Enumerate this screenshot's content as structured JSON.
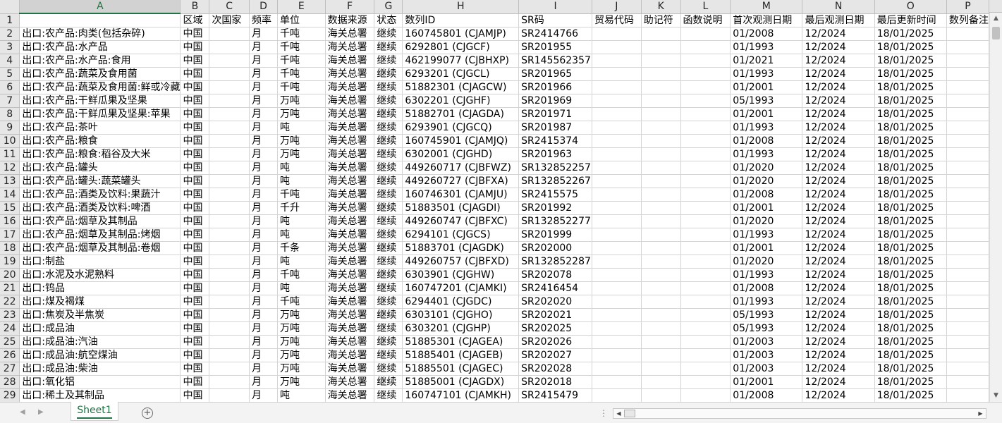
{
  "columns": [
    "A",
    "B",
    "C",
    "D",
    "E",
    "F",
    "G",
    "H",
    "I",
    "J",
    "K",
    "L",
    "M",
    "N",
    "O",
    "P"
  ],
  "selected_column": "A",
  "header_row": {
    "row_num": "1",
    "cells": [
      "",
      "区域",
      "次国家",
      "频率",
      "单位",
      "数据来源",
      "状态",
      "数列ID",
      "SR码",
      "贸易代码",
      "助记符",
      "函数说明",
      "首次观测日期",
      "最后观测日期",
      "最后更新时间",
      "数列备注"
    ]
  },
  "rows": [
    {
      "n": "2",
      "cells": [
        "出口:农产品:肉类(包括杂碎)",
        "中国",
        "",
        "月",
        "千吨",
        "海关总署",
        "继续",
        "160745801 (CJAMJP)",
        "SR2414766",
        "",
        "",
        "",
        "01/2008",
        "12/2024",
        "18/01/2025",
        ""
      ]
    },
    {
      "n": "3",
      "cells": [
        "出口:农产品:水产品",
        "中国",
        "",
        "月",
        "千吨",
        "海关总署",
        "继续",
        "6292801 (CJGCF)",
        "SR201955",
        "",
        "",
        "",
        "01/1993",
        "12/2024",
        "18/01/2025",
        ""
      ]
    },
    {
      "n": "4",
      "cells": [
        "出口:农产品:水产品:食用",
        "中国",
        "",
        "月",
        "千吨",
        "海关总署",
        "继续",
        "462199077 (CJBHXP)",
        "SR145562357",
        "",
        "",
        "",
        "01/2021",
        "12/2024",
        "18/01/2025",
        ""
      ]
    },
    {
      "n": "5",
      "cells": [
        "出口:农产品:蔬菜及食用菌",
        "中国",
        "",
        "月",
        "千吨",
        "海关总署",
        "继续",
        "6293201 (CJGCL)",
        "SR201965",
        "",
        "",
        "",
        "01/1993",
        "12/2024",
        "18/01/2025",
        ""
      ]
    },
    {
      "n": "6",
      "cells": [
        "出口:农产品:蔬菜及食用菌:鲜或冷藏",
        "中国",
        "",
        "月",
        "千吨",
        "海关总署",
        "继续",
        "51882301 (CJAGCW)",
        "SR201966",
        "",
        "",
        "",
        "01/2001",
        "12/2024",
        "18/01/2025",
        ""
      ]
    },
    {
      "n": "7",
      "cells": [
        "出口:农产品:干鲜瓜果及坚果",
        "中国",
        "",
        "月",
        "万吨",
        "海关总署",
        "继续",
        "6302201 (CJGHF)",
        "SR201969",
        "",
        "",
        "",
        "05/1993",
        "12/2024",
        "18/01/2025",
        ""
      ]
    },
    {
      "n": "8",
      "cells": [
        "出口:农产品:干鲜瓜果及坚果:苹果",
        "中国",
        "",
        "月",
        "万吨",
        "海关总署",
        "继续",
        "51882701 (CJAGDA)",
        "SR201971",
        "",
        "",
        "",
        "01/2001",
        "12/2024",
        "18/01/2025",
        ""
      ]
    },
    {
      "n": "9",
      "cells": [
        "出口:农产品:茶叶",
        "中国",
        "",
        "月",
        "吨",
        "海关总署",
        "继续",
        "6293901 (CJGCQ)",
        "SR201987",
        "",
        "",
        "",
        "01/1993",
        "12/2024",
        "18/01/2025",
        ""
      ]
    },
    {
      "n": "10",
      "cells": [
        "出口:农产品:粮食",
        "中国",
        "",
        "月",
        "万吨",
        "海关总署",
        "继续",
        "160745901 (CJAMJQ)",
        "SR2415374",
        "",
        "",
        "",
        "01/2008",
        "12/2024",
        "18/01/2025",
        ""
      ]
    },
    {
      "n": "11",
      "cells": [
        "出口:农产品:粮食:稻谷及大米",
        "中国",
        "",
        "月",
        "万吨",
        "海关总署",
        "继续",
        "6302001 (CJGHD)",
        "SR201963",
        "",
        "",
        "",
        "01/1993",
        "12/2024",
        "18/01/2025",
        ""
      ]
    },
    {
      "n": "12",
      "cells": [
        "出口:农产品:罐头",
        "中国",
        "",
        "月",
        "吨",
        "海关总署",
        "继续",
        "449260717 (CJBFWZ)",
        "SR132852257",
        "",
        "",
        "",
        "01/2020",
        "12/2024",
        "18/01/2025",
        ""
      ]
    },
    {
      "n": "13",
      "cells": [
        "出口:农产品:罐头:蔬菜罐头",
        "中国",
        "",
        "月",
        "吨",
        "海关总署",
        "继续",
        "449260727 (CJBFXA)",
        "SR132852267",
        "",
        "",
        "",
        "01/2020",
        "12/2024",
        "18/01/2025",
        ""
      ]
    },
    {
      "n": "14",
      "cells": [
        "出口:农产品:酒类及饮料:果蔬汁",
        "中国",
        "",
        "月",
        "千吨",
        "海关总署",
        "继续",
        "160746301 (CJAMJU)",
        "SR2415575",
        "",
        "",
        "",
        "01/2008",
        "12/2024",
        "18/01/2025",
        ""
      ]
    },
    {
      "n": "15",
      "cells": [
        "出口:农产品:酒类及饮料:啤酒",
        "中国",
        "",
        "月",
        "千升",
        "海关总署",
        "继续",
        "51883501 (CJAGDI)",
        "SR201992",
        "",
        "",
        "",
        "01/2001",
        "12/2024",
        "18/01/2025",
        ""
      ]
    },
    {
      "n": "16",
      "cells": [
        "出口:农产品:烟草及其制品",
        "中国",
        "",
        "月",
        "吨",
        "海关总署",
        "继续",
        "449260747 (CJBFXC)",
        "SR132852277",
        "",
        "",
        "",
        "01/2020",
        "12/2024",
        "18/01/2025",
        ""
      ]
    },
    {
      "n": "17",
      "cells": [
        "出口:农产品:烟草及其制品:烤烟",
        "中国",
        "",
        "月",
        "吨",
        "海关总署",
        "继续",
        "6294101 (CJGCS)",
        "SR201999",
        "",
        "",
        "",
        "01/1993",
        "12/2024",
        "18/01/2025",
        ""
      ]
    },
    {
      "n": "18",
      "cells": [
        "出口:农产品:烟草及其制品:卷烟",
        "中国",
        "",
        "月",
        "千条",
        "海关总署",
        "继续",
        "51883701 (CJAGDK)",
        "SR202000",
        "",
        "",
        "",
        "01/2001",
        "12/2024",
        "18/01/2025",
        ""
      ]
    },
    {
      "n": "19",
      "cells": [
        "出口:制盐",
        "中国",
        "",
        "月",
        "吨",
        "海关总署",
        "继续",
        "449260757 (CJBFXD)",
        "SR132852287",
        "",
        "",
        "",
        "01/2020",
        "12/2024",
        "18/01/2025",
        ""
      ]
    },
    {
      "n": "20",
      "cells": [
        "出口:水泥及水泥熟料",
        "中国",
        "",
        "月",
        "千吨",
        "海关总署",
        "继续",
        "6303901 (CJGHW)",
        "SR202078",
        "",
        "",
        "",
        "01/1993",
        "12/2024",
        "18/01/2025",
        ""
      ]
    },
    {
      "n": "21",
      "cells": [
        "出口:钨品",
        "中国",
        "",
        "月",
        "吨",
        "海关总署",
        "继续",
        "160747201 (CJAMKI)",
        "SR2416454",
        "",
        "",
        "",
        "01/2008",
        "12/2024",
        "18/01/2025",
        ""
      ]
    },
    {
      "n": "22",
      "cells": [
        "出口:煤及褐煤",
        "中国",
        "",
        "月",
        "千吨",
        "海关总署",
        "继续",
        "6294401 (CJGDC)",
        "SR202020",
        "",
        "",
        "",
        "01/1993",
        "12/2024",
        "18/01/2025",
        ""
      ]
    },
    {
      "n": "23",
      "cells": [
        "出口:焦炭及半焦炭",
        "中国",
        "",
        "月",
        "万吨",
        "海关总署",
        "继续",
        "6303101 (CJGHO)",
        "SR202021",
        "",
        "",
        "",
        "05/1993",
        "12/2024",
        "18/01/2025",
        ""
      ]
    },
    {
      "n": "24",
      "cells": [
        "出口:成品油",
        "中国",
        "",
        "月",
        "万吨",
        "海关总署",
        "继续",
        "6303201 (CJGHP)",
        "SR202025",
        "",
        "",
        "",
        "05/1993",
        "12/2024",
        "18/01/2025",
        ""
      ]
    },
    {
      "n": "25",
      "cells": [
        "出口:成品油:汽油",
        "中国",
        "",
        "月",
        "万吨",
        "海关总署",
        "继续",
        "51885301 (CJAGEA)",
        "SR202026",
        "",
        "",
        "",
        "01/2003",
        "12/2024",
        "18/01/2025",
        ""
      ]
    },
    {
      "n": "26",
      "cells": [
        "出口:成品油:航空煤油",
        "中国",
        "",
        "月",
        "万吨",
        "海关总署",
        "继续",
        "51885401 (CJAGEB)",
        "SR202027",
        "",
        "",
        "",
        "01/2003",
        "12/2024",
        "18/01/2025",
        ""
      ]
    },
    {
      "n": "27",
      "cells": [
        "出口:成品油:柴油",
        "中国",
        "",
        "月",
        "万吨",
        "海关总署",
        "继续",
        "51885501 (CJAGEC)",
        "SR202028",
        "",
        "",
        "",
        "01/2003",
        "12/2024",
        "18/01/2025",
        ""
      ]
    },
    {
      "n": "28",
      "cells": [
        "出口:氧化铝",
        "中国",
        "",
        "月",
        "万吨",
        "海关总署",
        "继续",
        "51885001 (CJAGDX)",
        "SR202018",
        "",
        "",
        "",
        "01/2001",
        "12/2024",
        "18/01/2025",
        ""
      ]
    },
    {
      "n": "29",
      "cells": [
        "出口:稀土及其制品",
        "中国",
        "",
        "月",
        "吨",
        "海关总署",
        "继续",
        "160747101 (CJAMKH)",
        "SR2415479",
        "",
        "",
        "",
        "01/2008",
        "12/2024",
        "18/01/2025",
        ""
      ]
    }
  ],
  "tabs": {
    "sheet1": "Sheet1",
    "add": "+"
  },
  "icons": {
    "nav_left": "◀",
    "nav_right": "▶",
    "scroll_up": "▲",
    "scroll_down": "▼",
    "splitter": "⋮"
  },
  "accent_color": "#217346"
}
